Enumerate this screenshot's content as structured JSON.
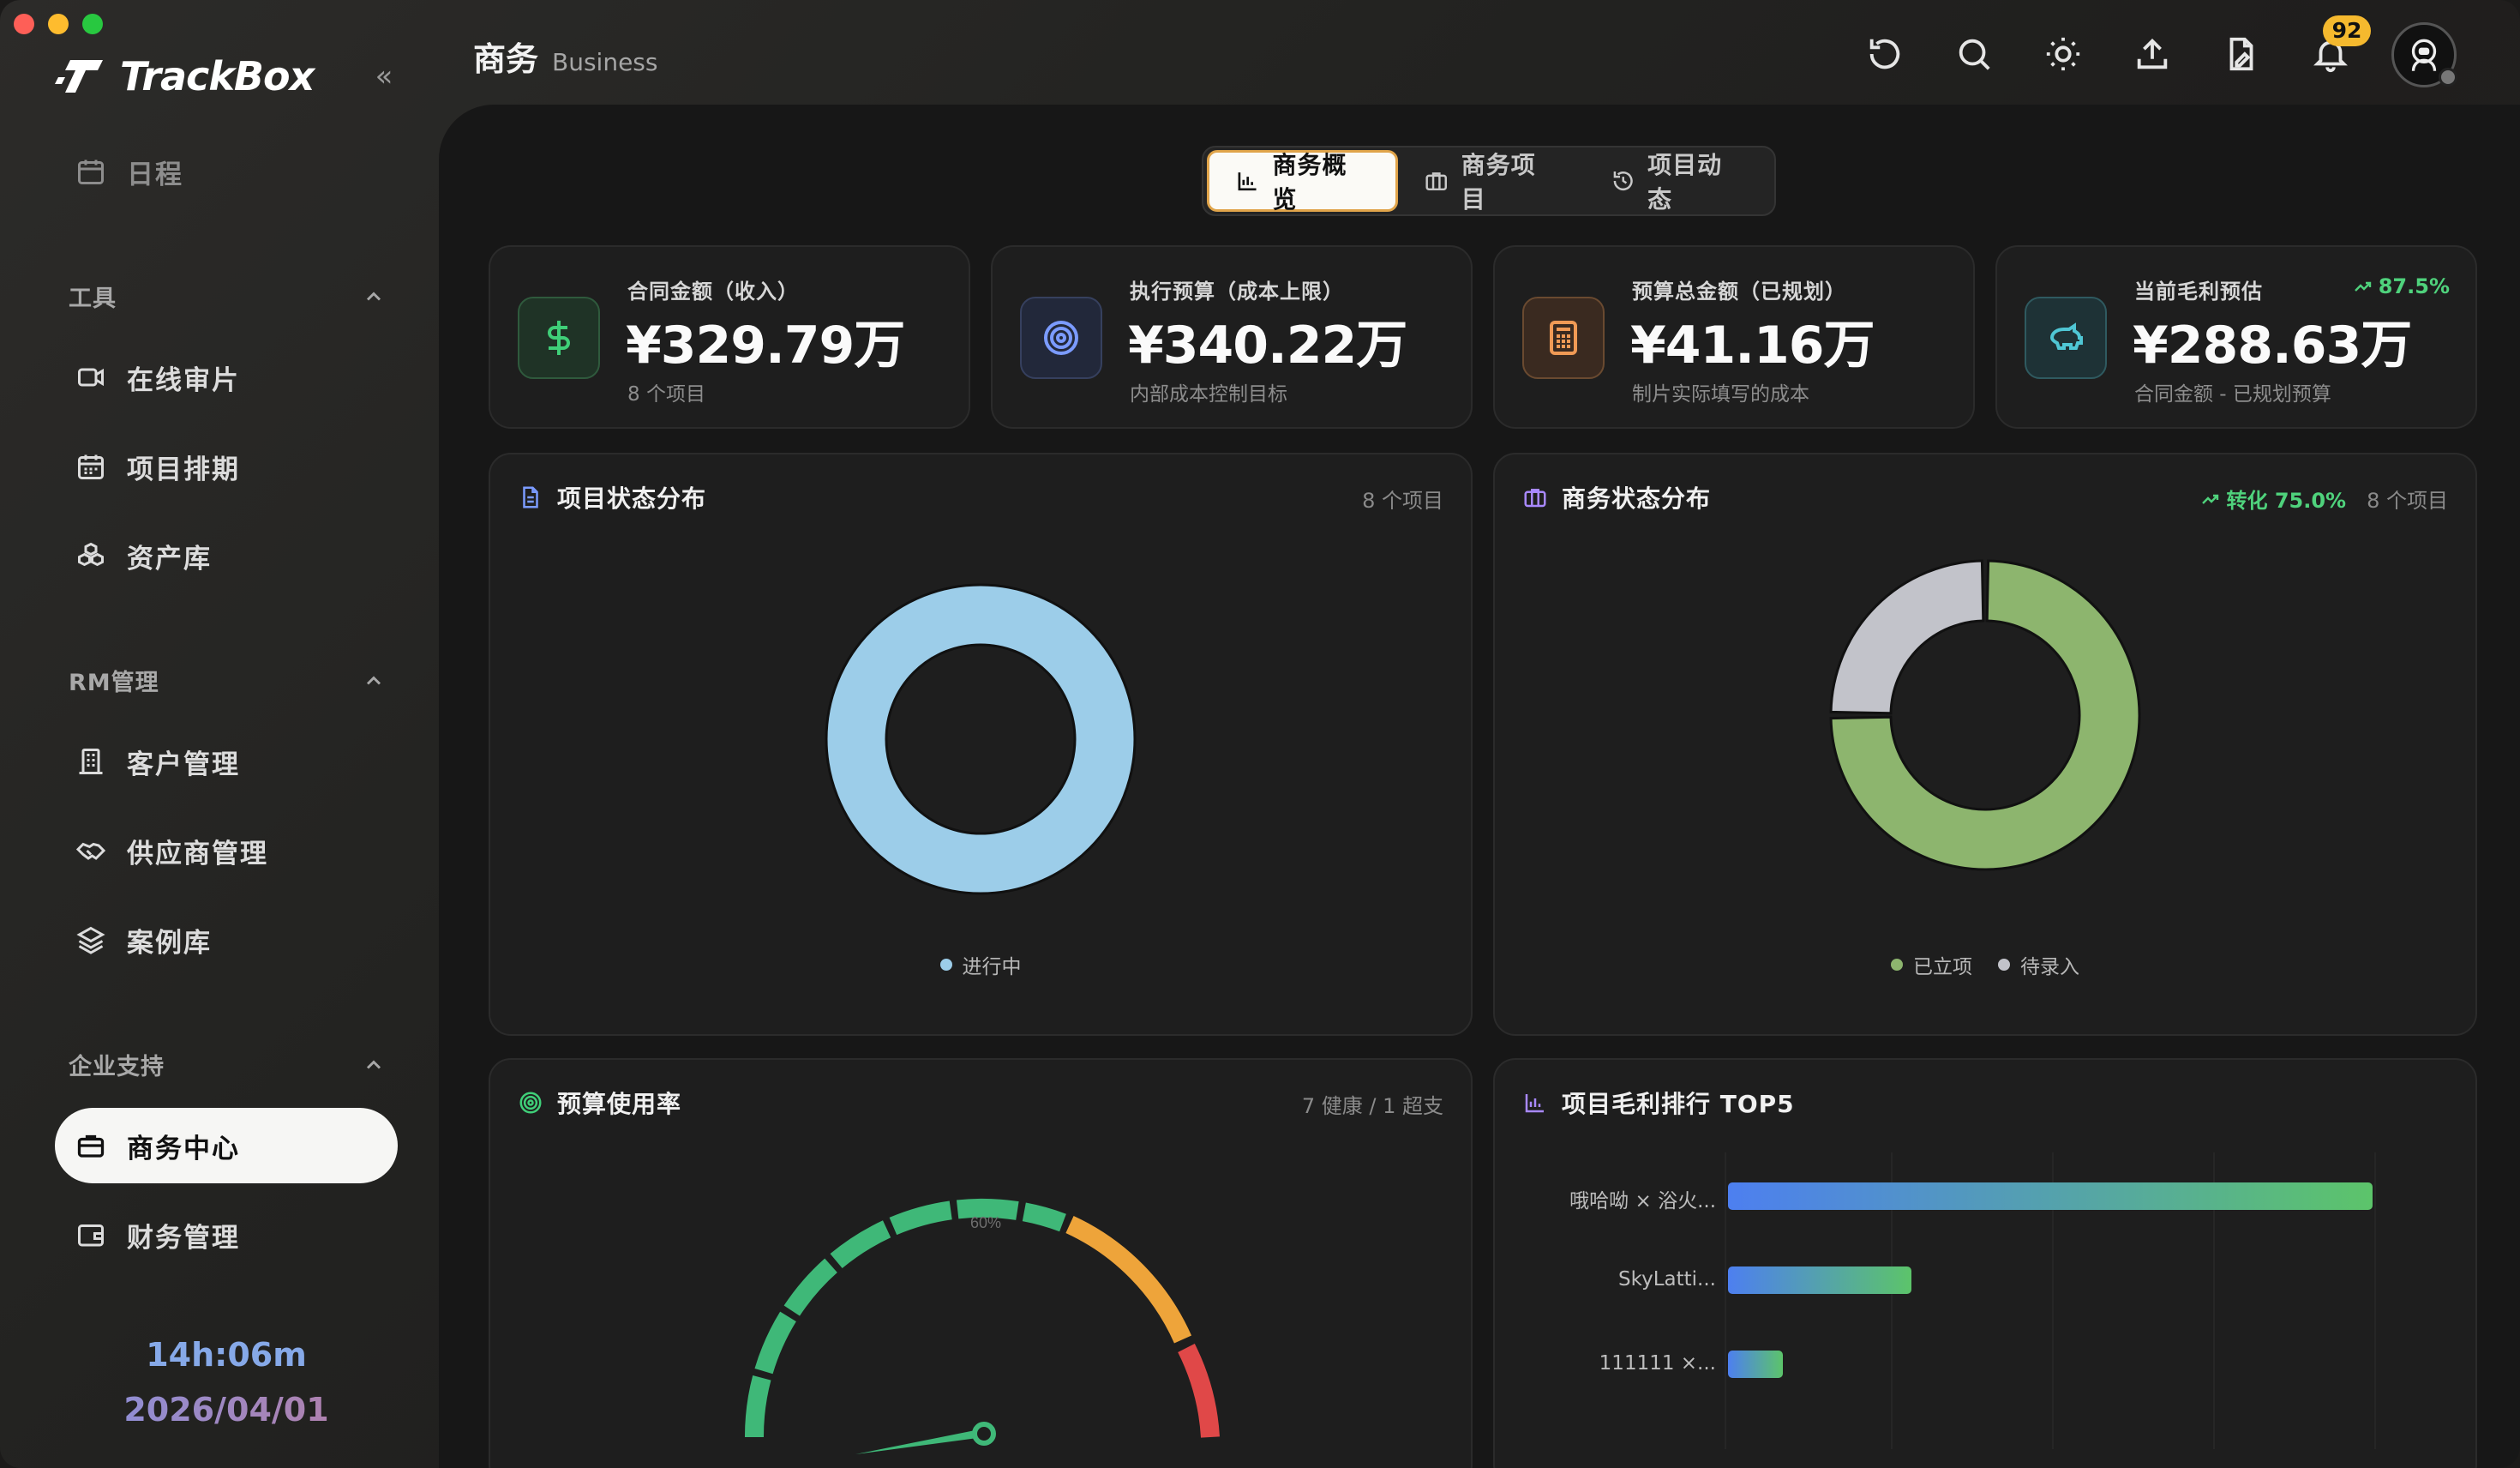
{
  "app": {
    "name": "TrackBox"
  },
  "sidebar": {
    "schedule": "日程",
    "sections": [
      {
        "title": "工具",
        "items": [
          "在线审片",
          "项目排期",
          "资产库"
        ]
      },
      {
        "title": "RM管理",
        "items": [
          "客户管理",
          "供应商管理",
          "案例库"
        ]
      },
      {
        "title": "企业支持",
        "items": [
          "商务中心",
          "财务管理"
        ]
      }
    ],
    "clock_time": "14h:06m",
    "clock_date": "2026/04/01"
  },
  "header": {
    "title_zh": "商务",
    "title_en": "Business",
    "notification_count": "92"
  },
  "tabs": [
    "商务概览",
    "商务项目",
    "项目动态"
  ],
  "stats": [
    {
      "label": "合同金额（收入）",
      "value": "¥329.79万",
      "sub": "8 个项目",
      "color": "#35b86a"
    },
    {
      "label": "执行预算（成本上限）",
      "value": "¥340.22万",
      "sub": "内部成本控制目标",
      "color": "#6f8ff0"
    },
    {
      "label": "预算总金额（已规划）",
      "value": "¥41.16万",
      "sub": "制片实际填写的成本",
      "color": "#e08a4a"
    },
    {
      "label": "当前毛利预估",
      "value": "¥288.63万",
      "sub": "合同金额 - 已规划预算",
      "trend": "87.5%",
      "color": "#3fb6c4"
    }
  ],
  "panels": {
    "project_status": {
      "title": "项目状态分布",
      "meta": "8 个项目"
    },
    "business_status": {
      "title": "商务状态分布",
      "conversion": "转化 75.0%",
      "meta": "8 个项目"
    },
    "budget_usage": {
      "title": "预算使用率",
      "meta": "7 健康 / 1 超支",
      "gauge_tick": "60%"
    },
    "margin_rank": {
      "title": "项目毛利排行 TOP5"
    }
  },
  "chart_data": [
    {
      "type": "pie",
      "title": "项目状态分布",
      "categories": [
        "进行中"
      ],
      "values": [
        8
      ],
      "colors": [
        "#9ccde9"
      ]
    },
    {
      "type": "pie",
      "title": "商务状态分布",
      "categories": [
        "已立项",
        "待录入"
      ],
      "values": [
        6,
        2
      ],
      "colors": [
        "#8db56e",
        "#c2c3ca"
      ]
    },
    {
      "type": "bar",
      "title": "项目毛利排行 TOP5",
      "categories": [
        "哦哈呦 × 浴火...",
        "SkyLatti...",
        "111111 ×..."
      ],
      "values": [
        100,
        28.5,
        8.5
      ]
    }
  ]
}
